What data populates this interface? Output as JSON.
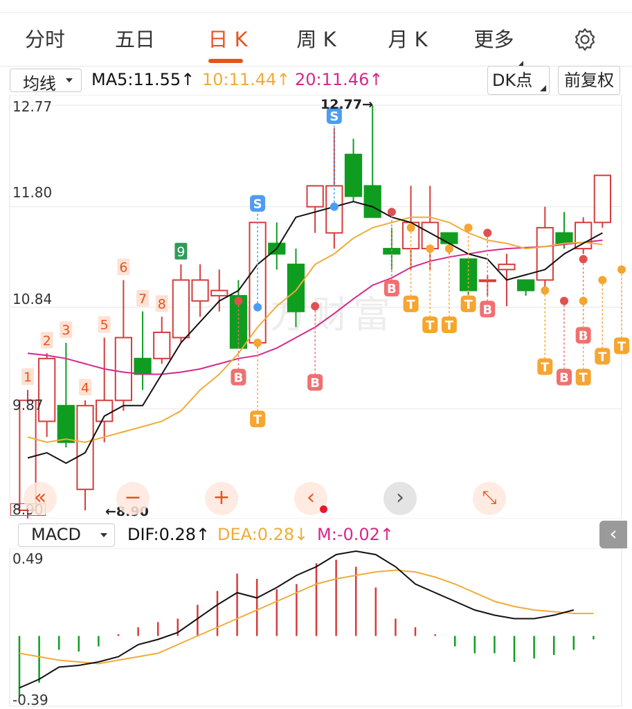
{
  "tabs": [
    {
      "label": "分时",
      "active": false
    },
    {
      "label": "五日",
      "active": false
    },
    {
      "label": "日 K",
      "active": true
    },
    {
      "label": "周 K",
      "active": false
    },
    {
      "label": "月 K",
      "active": false
    },
    {
      "label": "更多",
      "active": false
    }
  ],
  "settings_icon": "gear-icon",
  "ma_bar": {
    "selector": "均线",
    "ma5": "MA5:11.55",
    "ma10": "10:11.44",
    "ma20": "20:11.46",
    "up_arrow": "↑",
    "dk_label": "DK点",
    "fq_label": "前复权"
  },
  "kline": {
    "axis_labels": [
      "12.77",
      "11.80",
      "10.84",
      "9.87",
      "8.90"
    ],
    "high_note": "12.77→",
    "low_note": "←8.90",
    "watermark": "东方财富",
    "count_labels": [
      "1",
      "2",
      "3",
      "4",
      "5",
      "6",
      "7",
      "8",
      "9"
    ],
    "signal_s": "S",
    "signal_b": "B",
    "signal_t": "T"
  },
  "controls": [
    {
      "name": "prev-page",
      "glyph": "«"
    },
    {
      "name": "zoom-out",
      "glyph": "−"
    },
    {
      "name": "zoom-in",
      "glyph": "+"
    },
    {
      "name": "step-left",
      "glyph": "‹"
    },
    {
      "name": "step-right",
      "glyph": "›"
    },
    {
      "name": "fullscreen",
      "glyph": "⤡"
    }
  ],
  "macd_bar": {
    "selector": "MACD",
    "dif": "DIF:0.28↑",
    "dea": "DEA:0.28↓",
    "m": "M:-0.02↑"
  },
  "macd": {
    "axis_top": "0.49",
    "axis_bottom": "-0.39"
  },
  "side_button_glyph": "‹",
  "colors": {
    "accent": "#e8521f",
    "up": "#d63b3b",
    "down": "#0f9d20",
    "ma5": "#111111",
    "ma10": "#f0ac36",
    "ma20": "#d6288a"
  },
  "chart_data": [
    {
      "type": "candlestick",
      "ylim": [
        8.9,
        12.77
      ],
      "candles": [
        {
          "o": 8.9,
          "h": 10.05,
          "l": 8.8,
          "c": 9.95
        },
        {
          "o": 9.75,
          "h": 10.4,
          "l": 9.6,
          "c": 10.35
        },
        {
          "o": 9.9,
          "h": 10.5,
          "l": 9.5,
          "c": 9.55
        },
        {
          "o": 9.1,
          "h": 9.95,
          "l": 8.9,
          "c": 9.9
        },
        {
          "o": 9.75,
          "h": 10.55,
          "l": 9.55,
          "c": 9.95
        },
        {
          "o": 9.95,
          "h": 11.1,
          "l": 9.85,
          "c": 10.55
        },
        {
          "o": 10.35,
          "h": 10.8,
          "l": 10.05,
          "c": 10.2
        },
        {
          "o": 10.35,
          "h": 10.75,
          "l": 10.3,
          "c": 10.6
        },
        {
          "o": 10.55,
          "h": 11.25,
          "l": 10.5,
          "c": 11.1
        },
        {
          "o": 10.9,
          "h": 11.25,
          "l": 10.75,
          "c": 11.1
        },
        {
          "o": 10.95,
          "h": 11.2,
          "l": 10.8,
          "c": 11.0
        },
        {
          "o": 10.95,
          "h": 11.1,
          "l": 10.45,
          "c": 10.45
        },
        {
          "o": 10.5,
          "h": 11.65,
          "l": 10.45,
          "c": 11.65
        },
        {
          "o": 11.45,
          "h": 11.65,
          "l": 11.2,
          "c": 11.35
        },
        {
          "o": 11.25,
          "h": 11.4,
          "l": 10.65,
          "c": 10.8
        },
        {
          "o": 11.8,
          "h": 11.95,
          "l": 11.55,
          "c": 12.0
        },
        {
          "o": 11.55,
          "h": 12.55,
          "l": 11.4,
          "c": 12.0
        },
        {
          "o": 12.3,
          "h": 12.45,
          "l": 11.85,
          "c": 11.9
        },
        {
          "o": 12.0,
          "h": 12.77,
          "l": 11.8,
          "c": 11.7
        },
        {
          "o": 11.4,
          "h": 11.6,
          "l": 11.2,
          "c": 11.35
        },
        {
          "o": 11.4,
          "h": 12.0,
          "l": 11.2,
          "c": 11.65
        },
        {
          "o": 11.4,
          "h": 12.0,
          "l": 11.2,
          "c": 11.65
        },
        {
          "o": 11.55,
          "h": 11.55,
          "l": 11.35,
          "c": 11.45
        },
        {
          "o": 11.3,
          "h": 11.3,
          "l": 10.85,
          "c": 11.0
        },
        {
          "o": 11.1,
          "h": 11.15,
          "l": 10.95,
          "c": 11.1
        },
        {
          "o": 11.2,
          "h": 11.35,
          "l": 10.85,
          "c": 11.25
        },
        {
          "o": 11.1,
          "h": 11.1,
          "l": 10.95,
          "c": 11.0
        },
        {
          "o": 11.1,
          "h": 11.8,
          "l": 11.0,
          "c": 11.6
        },
        {
          "o": 11.55,
          "h": 11.75,
          "l": 11.4,
          "c": 11.45
        },
        {
          "o": 11.4,
          "h": 11.7,
          "l": 11.35,
          "c": 11.65
        },
        {
          "o": 11.65,
          "h": 12.1,
          "l": 11.6,
          "c": 12.1
        }
      ],
      "ma5": [
        9.4,
        9.45,
        9.35,
        9.45,
        9.8,
        9.9,
        9.9,
        10.2,
        10.5,
        10.7,
        10.9,
        11.0,
        11.25,
        11.4,
        11.7,
        11.75,
        11.8,
        11.85,
        11.8,
        11.7,
        11.65,
        11.55,
        11.45,
        11.35,
        11.3,
        11.1,
        11.15,
        11.2,
        11.35,
        11.45,
        11.55
      ],
      "ma10": [
        9.6,
        9.55,
        9.58,
        9.55,
        9.6,
        9.65,
        9.7,
        9.75,
        9.85,
        10.05,
        10.2,
        10.4,
        10.65,
        10.85,
        11.0,
        11.25,
        11.35,
        11.5,
        11.6,
        11.65,
        11.7,
        11.7,
        11.65,
        11.55,
        11.48,
        11.45,
        11.4,
        11.42,
        11.45,
        11.46,
        11.44
      ],
      "ma20": [
        10.4,
        10.38,
        10.35,
        10.3,
        10.25,
        10.22,
        10.2,
        10.2,
        10.22,
        10.25,
        10.3,
        10.35,
        10.38,
        10.45,
        10.55,
        10.65,
        10.78,
        10.92,
        11.05,
        11.12,
        11.22,
        11.28,
        11.32,
        11.35,
        11.38,
        11.4,
        11.41,
        11.42,
        11.44,
        11.46,
        11.48
      ],
      "signals": [
        {
          "i": 12,
          "kind": "S",
          "pos": "top",
          "price": 10.84
        },
        {
          "i": 16,
          "kind": "S",
          "pos": "top",
          "price": 11.8
        },
        {
          "i": 11,
          "kind": "B",
          "pos": "bottom",
          "price": 10.9
        },
        {
          "i": 15,
          "kind": "B",
          "pos": "bottom",
          "price": 10.85
        },
        {
          "i": 19,
          "kind": "B",
          "pos": "bottom",
          "price": 11.75
        },
        {
          "i": 24,
          "kind": "B",
          "pos": "bottom",
          "price": 11.55
        },
        {
          "i": 28,
          "kind": "B",
          "pos": "bottom",
          "price": 10.9
        },
        {
          "i": 29,
          "kind": "B",
          "pos": "bottom",
          "price": 11.3
        },
        {
          "i": 12,
          "kind": "T",
          "pos": "bottom",
          "price": 10.5
        },
        {
          "i": 20,
          "kind": "T",
          "pos": "bottom",
          "price": 11.6
        },
        {
          "i": 21,
          "kind": "T",
          "pos": "bottom",
          "price": 11.4
        },
        {
          "i": 22,
          "kind": "T",
          "pos": "bottom",
          "price": 11.4
        },
        {
          "i": 23,
          "kind": "T",
          "pos": "bottom",
          "price": 11.6
        },
        {
          "i": 27,
          "kind": "T",
          "pos": "bottom",
          "price": 11.0
        },
        {
          "i": 29,
          "kind": "T",
          "pos": "bottom",
          "price": 10.9
        },
        {
          "i": 30,
          "kind": "T",
          "pos": "bottom",
          "price": 11.1
        },
        {
          "i": 31,
          "kind": "T",
          "pos": "bottom",
          "price": 11.2
        },
        {
          "i": 32,
          "kind": "T",
          "pos": "bottom",
          "price": 11.4
        }
      ]
    },
    {
      "type": "macd",
      "ylim": [
        -0.39,
        0.49
      ],
      "dif": [
        -0.3,
        -0.25,
        -0.18,
        -0.17,
        -0.15,
        -0.12,
        -0.05,
        -0.02,
        0.02,
        0.1,
        0.18,
        0.25,
        0.22,
        0.28,
        0.35,
        0.4,
        0.47,
        0.49,
        0.47,
        0.4,
        0.3,
        0.25,
        0.2,
        0.15,
        0.12,
        0.1,
        0.1,
        0.12,
        0.15
      ],
      "dea": [
        -0.1,
        -0.12,
        -0.14,
        -0.15,
        -0.16,
        -0.14,
        -0.12,
        -0.1,
        -0.05,
        0.0,
        0.05,
        0.1,
        0.15,
        0.2,
        0.25,
        0.3,
        0.33,
        0.35,
        0.37,
        0.38,
        0.37,
        0.34,
        0.3,
        0.25,
        0.2,
        0.17,
        0.15,
        0.14,
        0.13,
        0.13
      ],
      "m": [
        -0.35,
        -0.27,
        -0.08,
        -0.09,
        -0.06,
        0.01,
        0.05,
        0.08,
        0.1,
        0.18,
        0.26,
        0.36,
        0.33,
        0.27,
        0.3,
        0.42,
        0.44,
        0.4,
        0.28,
        0.1,
        0.05,
        0.01,
        -0.06,
        -0.1,
        -0.1,
        -0.15,
        -0.13,
        -0.11,
        -0.08,
        -0.02
      ]
    }
  ]
}
